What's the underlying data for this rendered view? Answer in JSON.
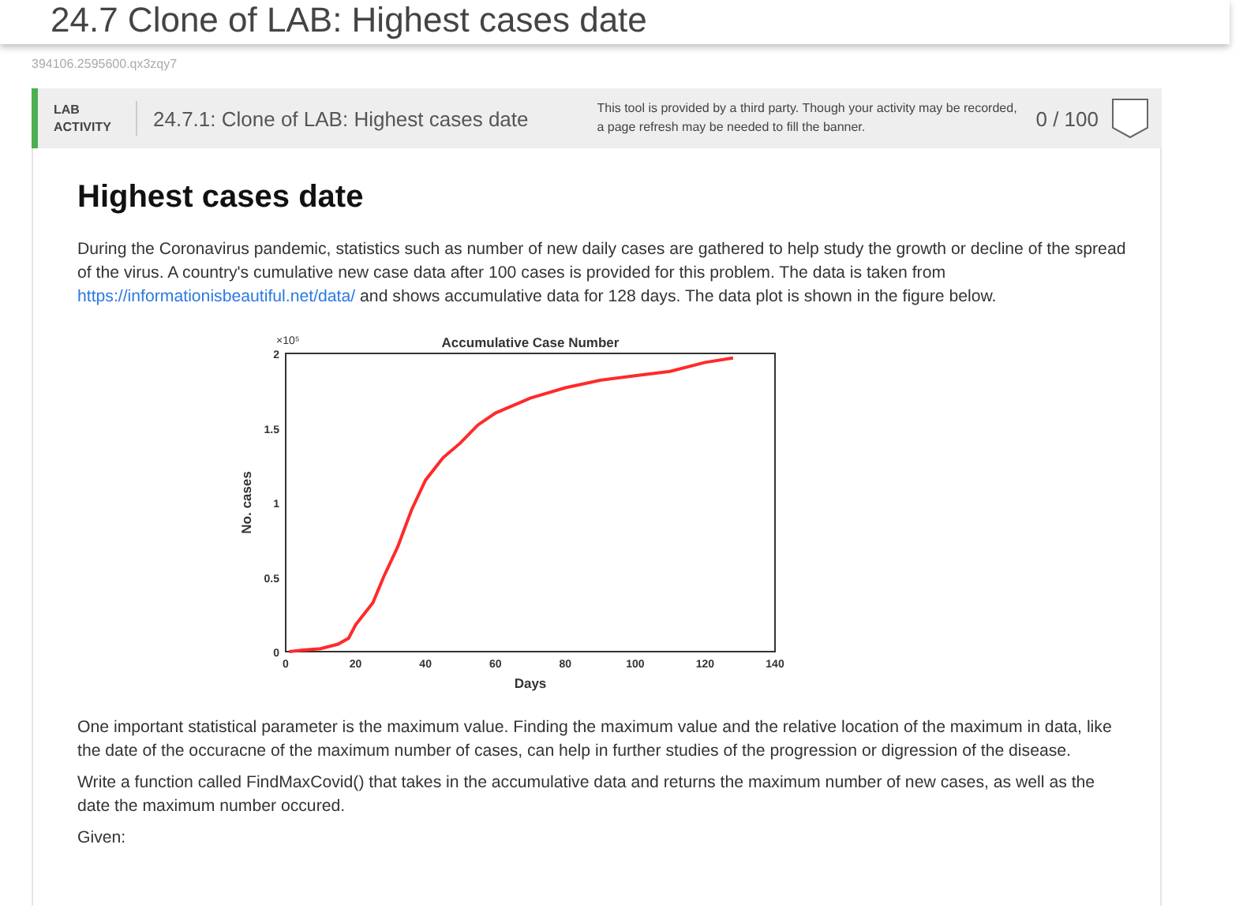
{
  "page_title": "24.7 Clone of LAB: Highest cases date",
  "content_id": "394106.2595600.qx3zqy7",
  "lab_banner": {
    "tag": "LAB ACTIVITY",
    "title": "24.7.1: Clone of LAB: Highest cases date",
    "notice": "This tool is provided by a third party. Though your activity may be recorded, a page refresh may be needed to fill the banner.",
    "score": "0 / 100"
  },
  "heading": "Highest cases date",
  "paragraphs": [
    {
      "before": "During the Coronavirus pandemic, statistics such as number of new daily cases are gathered to help study the growth or decline of the spread of the virus.  A country's cumulative new case data after 100 cases is provided for this problem. The data is taken from ",
      "link": "https://informationisbeautiful.net/data/",
      "after": " and shows accumulative data for 128 days. The data plot is shown in the figure below."
    }
  ],
  "figure": {
    "chart_data": {
      "type": "line",
      "title": "Accumulative Case Number",
      "xlabel": "Days",
      "ylabel": "No. cases",
      "x": [
        1,
        5,
        10,
        15,
        18,
        20,
        25,
        28,
        32,
        36,
        40,
        45,
        50,
        55,
        60,
        65,
        70,
        80,
        90,
        100,
        110,
        120,
        128
      ],
      "series": [
        {
          "color": "#ff2a2a",
          "values": [
            0,
            0.01,
            0.02,
            0.05,
            0.09,
            0.18,
            0.33,
            0.5,
            0.7,
            0.95,
            1.15,
            1.3,
            1.4,
            1.52,
            1.6,
            1.65,
            1.7,
            1.77,
            1.82,
            1.85,
            1.88,
            1.94,
            1.97
          ]
        }
      ],
      "xlim": [
        0,
        140
      ],
      "ylim": [
        0,
        2
      ],
      "xticks": [
        0,
        20,
        40,
        60,
        80,
        100,
        120,
        140
      ],
      "yticks": [
        0,
        0.5,
        1,
        1.5,
        2
      ],
      "annotations": [
        "×10⁵"
      ]
    }
  },
  "after_paragraphs": [
    "One important statistical parameter is the maximum value. Finding the maximum value and the relative location of the maximum in data, like the date of the occuracne of the maximum number of cases, can help in further studies of the progression or digression of the disease.",
    "Write a function called FindMaxCovid() that takes in the accumulative data and returns the maximum number of new cases, as well as the date the maximum number occured.",
    "Given:"
  ]
}
